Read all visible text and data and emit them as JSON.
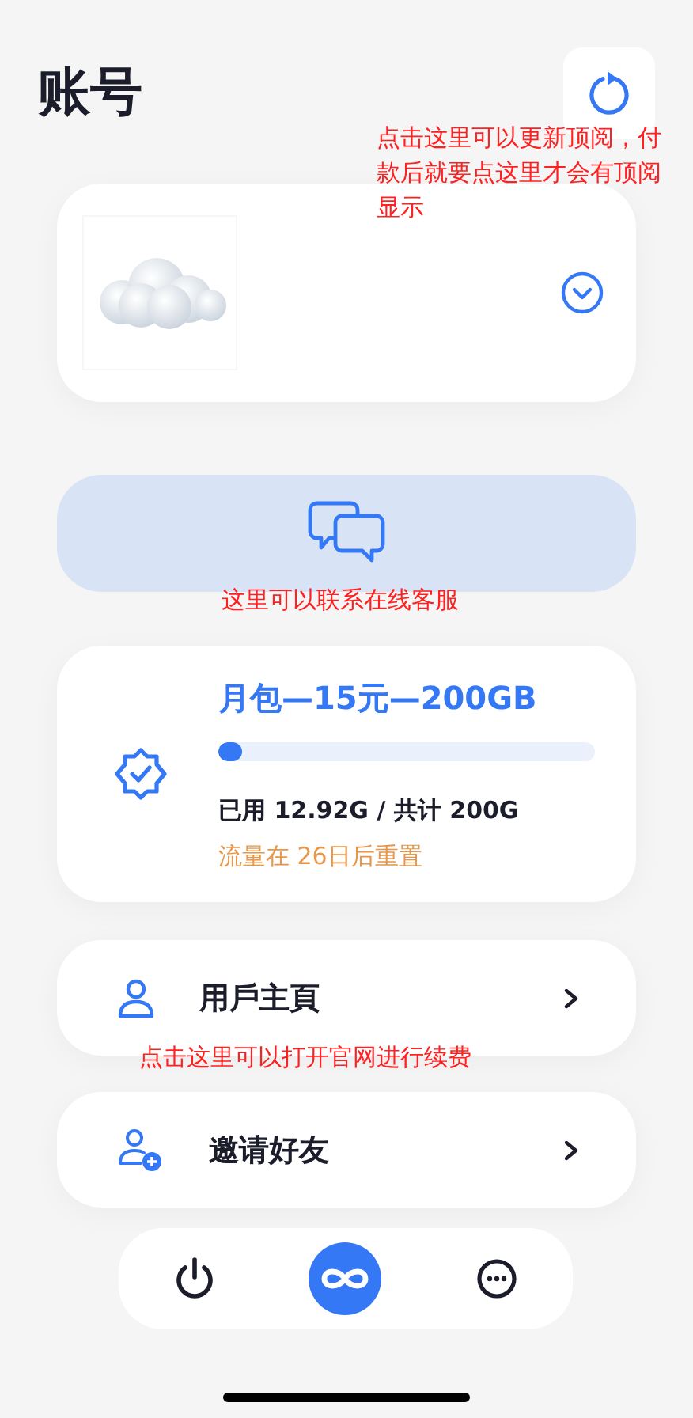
{
  "title": "账号",
  "plan": {
    "name": "月包—15元—200GB",
    "level": 0.065,
    "usage": "已用 12.92G / 共计 200G",
    "reset": "流量在 26日后重置"
  },
  "menu": [
    {
      "kind": "profile",
      "label": "用戶主頁"
    },
    {
      "kind": "invite",
      "label": "邀请好友"
    }
  ],
  "nav": [
    {
      "kind": "power",
      "selected": false
    },
    {
      "kind": "infinity",
      "selected": true
    },
    {
      "kind": "more",
      "selected": false
    }
  ],
  "annotations": [
    {
      "kind": "refresh",
      "text": "点击这里可以更新顶阅，付款后就要点这里才会有顶阅显示"
    },
    {
      "kind": "support",
      "text": "这里可以联系在线客服"
    },
    {
      "kind": "renew",
      "text": "点击这里可以打开官网进行续费"
    }
  ]
}
